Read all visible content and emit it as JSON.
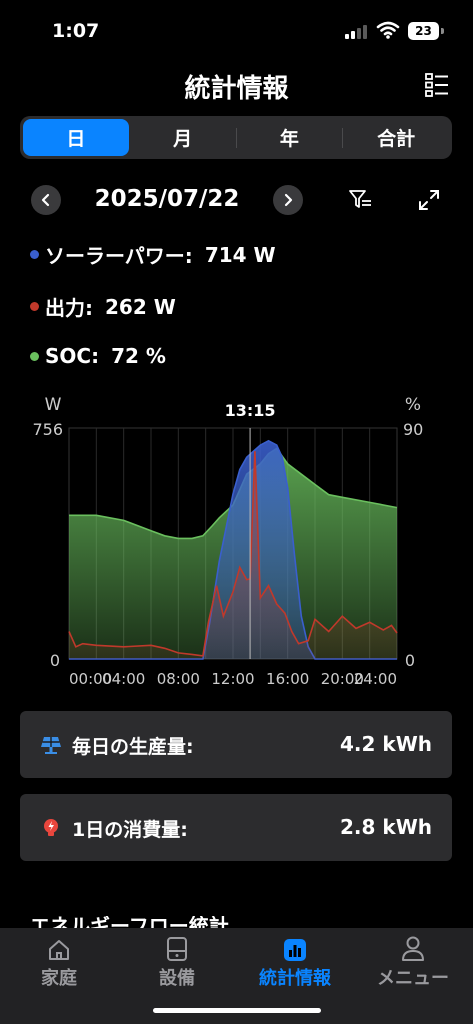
{
  "status": {
    "time": "1:07",
    "battery": "23"
  },
  "header": {
    "title": "統計情報"
  },
  "tabs": [
    "日",
    "月",
    "年",
    "合計"
  ],
  "date": "2025/07/22",
  "legend": [
    {
      "label": "ソーラーパワー:",
      "value": "714 W",
      "color": "#3a5fcd"
    },
    {
      "label": "出力:",
      "value": "262 W",
      "color": "#c0392b"
    },
    {
      "label": "SOC:",
      "value": "72 %",
      "color": "#6abf5e"
    }
  ],
  "chart_data": {
    "type": "area",
    "y_left_label": "W",
    "y_right_label": "%",
    "y_left_max": "756",
    "y_left_min": "0",
    "y_right_max": "90",
    "y_right_min": "0",
    "ylim_left": [
      0,
      756
    ],
    "ylim_right": [
      0,
      90
    ],
    "cursor_label": "13:15",
    "cursor_hour": 13.25,
    "x_ticks": [
      "00:00",
      "04:00",
      "08:00",
      "12:00",
      "16:00",
      "20:00",
      "24:00"
    ],
    "series": [
      {
        "name": "SOC",
        "color": "#6abf5e",
        "unit": "%",
        "points": [
          [
            0,
            56
          ],
          [
            2,
            56
          ],
          [
            4,
            54
          ],
          [
            6,
            50
          ],
          [
            7,
            48
          ],
          [
            8,
            47
          ],
          [
            9,
            47
          ],
          [
            9.8,
            48
          ],
          [
            10.5,
            52
          ],
          [
            11,
            55
          ],
          [
            12,
            60
          ],
          [
            13,
            72
          ],
          [
            14,
            76
          ],
          [
            14.6,
            80
          ],
          [
            15.2,
            82
          ],
          [
            16,
            76
          ],
          [
            17,
            72
          ],
          [
            18,
            68
          ],
          [
            19,
            64
          ],
          [
            20,
            63
          ],
          [
            22,
            61
          ],
          [
            24,
            59
          ]
        ]
      },
      {
        "name": "ソーラーパワー",
        "color": "#3a5fcd",
        "unit": "W",
        "points": [
          [
            0,
            0
          ],
          [
            9.8,
            0
          ],
          [
            10.3,
            120
          ],
          [
            11,
            320
          ],
          [
            12,
            540
          ],
          [
            12.5,
            620
          ],
          [
            13,
            660
          ],
          [
            14,
            700
          ],
          [
            14.6,
            714
          ],
          [
            15.2,
            700
          ],
          [
            15.6,
            660
          ],
          [
            16,
            560
          ],
          [
            16.5,
            340
          ],
          [
            17,
            140
          ],
          [
            17.5,
            40
          ],
          [
            18,
            0
          ],
          [
            24,
            0
          ]
        ]
      },
      {
        "name": "出力",
        "color": "#c0392b",
        "unit": "W",
        "points": [
          [
            0,
            90
          ],
          [
            0.5,
            40
          ],
          [
            1,
            50
          ],
          [
            2,
            45
          ],
          [
            4,
            40
          ],
          [
            6,
            45
          ],
          [
            7,
            35
          ],
          [
            8,
            20
          ],
          [
            9,
            15
          ],
          [
            9.8,
            10
          ],
          [
            10.2,
            120
          ],
          [
            10.8,
            240
          ],
          [
            11.3,
            140
          ],
          [
            12,
            220
          ],
          [
            12.5,
            300
          ],
          [
            13,
            260
          ],
          [
            13.25,
            262
          ],
          [
            13.6,
            680
          ],
          [
            14,
            200
          ],
          [
            14.6,
            240
          ],
          [
            15.2,
            180
          ],
          [
            15.8,
            150
          ],
          [
            16.3,
            90
          ],
          [
            16.8,
            50
          ],
          [
            17.5,
            60
          ],
          [
            18,
            130
          ],
          [
            19,
            90
          ],
          [
            20,
            140
          ],
          [
            21,
            100
          ],
          [
            22,
            120
          ],
          [
            23,
            95
          ],
          [
            23.6,
            110
          ],
          [
            24,
            85
          ]
        ]
      }
    ]
  },
  "cards": [
    {
      "label": "毎日の生産量:",
      "value": "4.2 kWh"
    },
    {
      "label": "1日の消費量:",
      "value": "2.8 kWh"
    }
  ],
  "section_peek": "エネルギーフロー統計",
  "tabbar": [
    "家庭",
    "設備",
    "統計情報",
    "メニュー"
  ]
}
